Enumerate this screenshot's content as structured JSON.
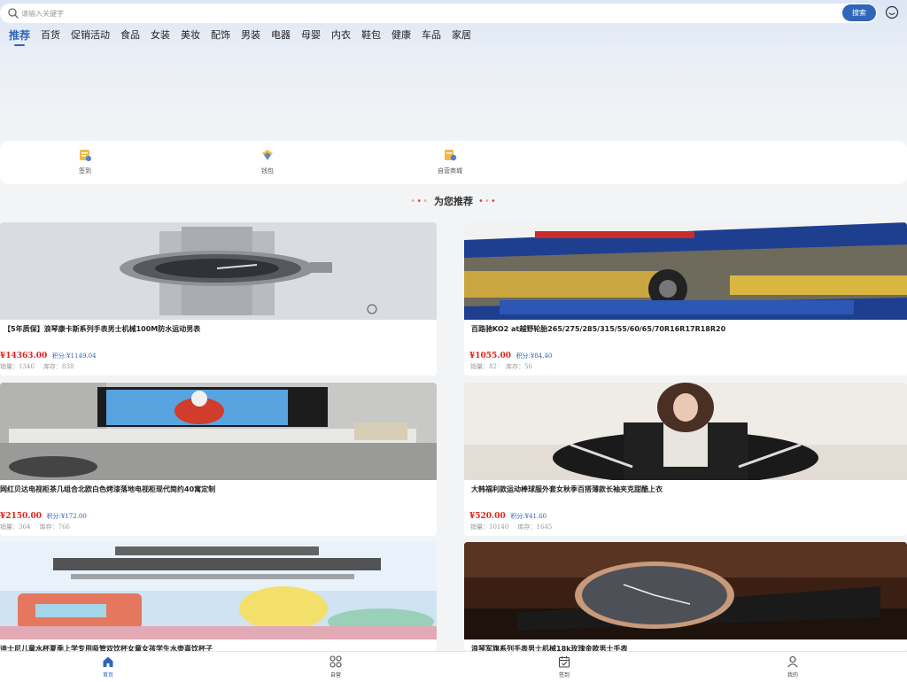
{
  "search": {
    "placeholder": "请输入关键字",
    "button_label": "搜索"
  },
  "categories": [
    "推荐",
    "百货",
    "促销活动",
    "食品",
    "女装",
    "美妆",
    "配饰",
    "男装",
    "电器",
    "母婴",
    "内衣",
    "鞋包",
    "健康",
    "车品",
    "家居"
  ],
  "active_category": "推荐",
  "quick_nav": [
    {
      "label": "签到",
      "icon": "checkin-icon"
    },
    {
      "label": "钱包",
      "icon": "wallet-icon"
    },
    {
      "label": "自营商城",
      "icon": "store-icon"
    }
  ],
  "recommend_title": "为您推荐",
  "products": [
    {
      "name": "【5年质保】浪琴康卡斯系列手表男士机械100M防水运动男表",
      "price": "¥14363.00",
      "points": "积分:¥1149.04",
      "sales": "销量：1346",
      "stock": "库存：838"
    },
    {
      "name": "百路驰KO2 at越野轮胎265/275/285/315/55/60/65/70R16R17R18R20",
      "price": "¥1055.00",
      "points": "积分:¥84.40",
      "sales": "销量：82",
      "stock": "库存：56"
    },
    {
      "name": "网红贝达电视柜茶几组合北欧白色烤漆落地电视柜现代简约40寓定制",
      "price": "¥2150.00",
      "points": "积分:¥172.00",
      "sales": "销量：364",
      "stock": "库存：766"
    },
    {
      "name": "大韩福利款运动棒球服外套女秋季百搭薄款长袖夹克甜酷上衣",
      "price": "¥520.00",
      "points": "积分:¥41.60",
      "sales": "销量：10140",
      "stock": "库存：1645"
    },
    {
      "name": "迪士尼儿童水杯夏季上学专用吸管双饮杯女童女孩学生水壶喜饮杯子",
      "price": "",
      "points": "",
      "sales": "",
      "stock": ""
    },
    {
      "name": "浪琴军旗系列手表男士机械18k玫瑰金款男士手表",
      "price": "",
      "points": "",
      "sales": "",
      "stock": ""
    }
  ],
  "tabs": [
    {
      "label": "首页",
      "icon": "home-icon",
      "active": true
    },
    {
      "label": "自营",
      "icon": "grid-icon",
      "active": false
    },
    {
      "label": "签到",
      "icon": "calendar-check-icon",
      "active": false
    },
    {
      "label": "我的",
      "icon": "user-icon",
      "active": false
    }
  ],
  "colors": {
    "accent": "#2f66b8",
    "price": "#e2231a"
  }
}
